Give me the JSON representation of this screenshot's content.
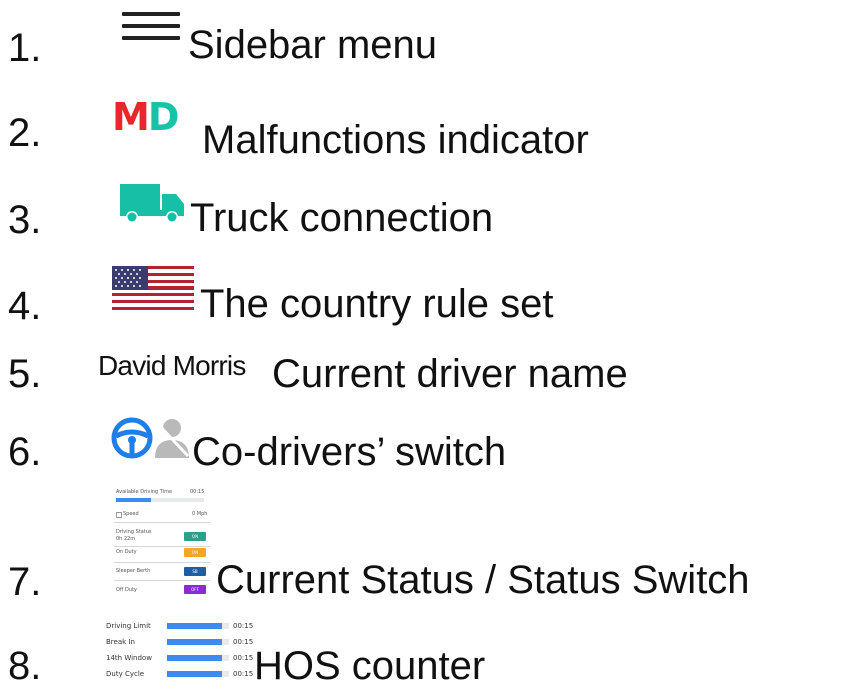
{
  "colors": {
    "md_m": "#e8262c",
    "md_d": "#18c2a7",
    "truck": "#17bfa6",
    "steering": "#1f7ee8",
    "person": "#b9b9b9",
    "status_on": "#2ea089",
    "status_onduty": "#f5a623",
    "status_sleeper": "#1d5fa6",
    "status_off": "#8a2bd6",
    "progress": "#3d8bf0"
  },
  "items": [
    {
      "number": "1.",
      "icon": "hamburger-icon",
      "label": "Sidebar menu"
    },
    {
      "number": "2.",
      "icon": "md-icon",
      "icon_text_m": "M",
      "icon_text_d": "D",
      "label": "Malfunctions indicator"
    },
    {
      "number": "3.",
      "icon": "truck-icon",
      "label": "Truck connection"
    },
    {
      "number": "4.",
      "icon": "us-flag-icon",
      "label": "The country rule set"
    },
    {
      "number": "5.",
      "icon_text": "David Morris",
      "label": "Current driver name"
    },
    {
      "number": "6.",
      "icon": "steering-wheel-icon",
      "icon2": "person-icon",
      "label": "Co-drivers’ switch"
    },
    {
      "number": "7.",
      "icon": "status-panel",
      "label": "Current Status / Status Switch"
    },
    {
      "number": "8.",
      "icon": "hos-counter",
      "label": "HOS counter"
    }
  ],
  "status_panel": {
    "available_label": "Available Driving Time",
    "available_value": "00:15",
    "available_progress": 0.4,
    "speed_label": "Speed",
    "speed_value": "0 Mph",
    "driving_status_label": "Driving Status",
    "driving_status_time": "0h 22m",
    "driving_status_btn": "ON",
    "on_duty_label": "On Duty",
    "on_duty_btn": "ON",
    "sleeper_label": "Sleeper Berth",
    "sleeper_btn": "SB",
    "off_duty_label": "Off Duty",
    "off_duty_btn": "OFF"
  },
  "hos": {
    "rows": [
      {
        "label": "Driving Limit",
        "value": "00:15",
        "progress": 0.88
      },
      {
        "label": "Break In",
        "value": "00:15",
        "progress": 0.88
      },
      {
        "label": "14th Window",
        "value": "00:15",
        "progress": 0.88
      },
      {
        "label": "Duty Cycle",
        "value": "00:15",
        "progress": 0.88
      }
    ]
  }
}
